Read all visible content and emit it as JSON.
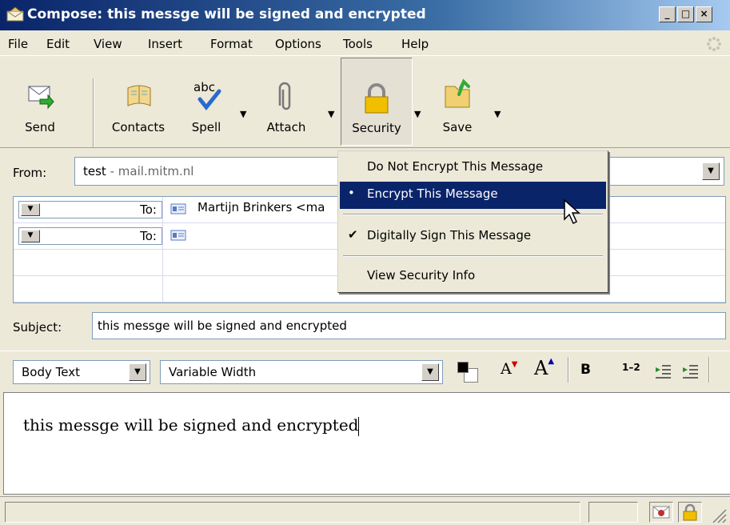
{
  "window": {
    "title": "Compose: this messge will be signed and encrypted",
    "minimize": "_",
    "maximize": "□",
    "close": "×"
  },
  "menubar": {
    "items": [
      "File",
      "Edit",
      "View",
      "Insert",
      "Format",
      "Options",
      "Tools",
      "Help"
    ]
  },
  "toolbar": {
    "send": "Send",
    "contacts": "Contacts",
    "spell": "Spell",
    "attach": "Attach",
    "security": "Security",
    "save": "Save",
    "dropdown_glyph": "▼"
  },
  "from": {
    "label": "From:",
    "name": "test",
    "account": " - mail.mitm.nl"
  },
  "recipients": [
    {
      "type": "To:",
      "address": "Martijn Brinkers <ma"
    },
    {
      "type": "To:",
      "address": ""
    }
  ],
  "subject": {
    "label": "Subject:",
    "value": "this messge will be signed and encrypted"
  },
  "format": {
    "paragraph": "Body Text",
    "font": "Variable Width",
    "smaller": "A",
    "larger": "A",
    "bold": "B",
    "numbered": "1–2",
    "text_color": "#000000"
  },
  "body": {
    "text": "this messge will be signed and encrypted"
  },
  "security_menu": {
    "items": [
      {
        "label": "Do Not Encrypt This Message",
        "mark": ""
      },
      {
        "label": "Encrypt This Message",
        "mark": "•"
      },
      {
        "label": "Digitally Sign This Message",
        "mark": "✔"
      },
      {
        "label": "View Security Info",
        "mark": ""
      }
    ]
  },
  "colors": {
    "titlebar": "#0a246a",
    "highlight": "#0a246a",
    "face": "#ece9d8"
  }
}
